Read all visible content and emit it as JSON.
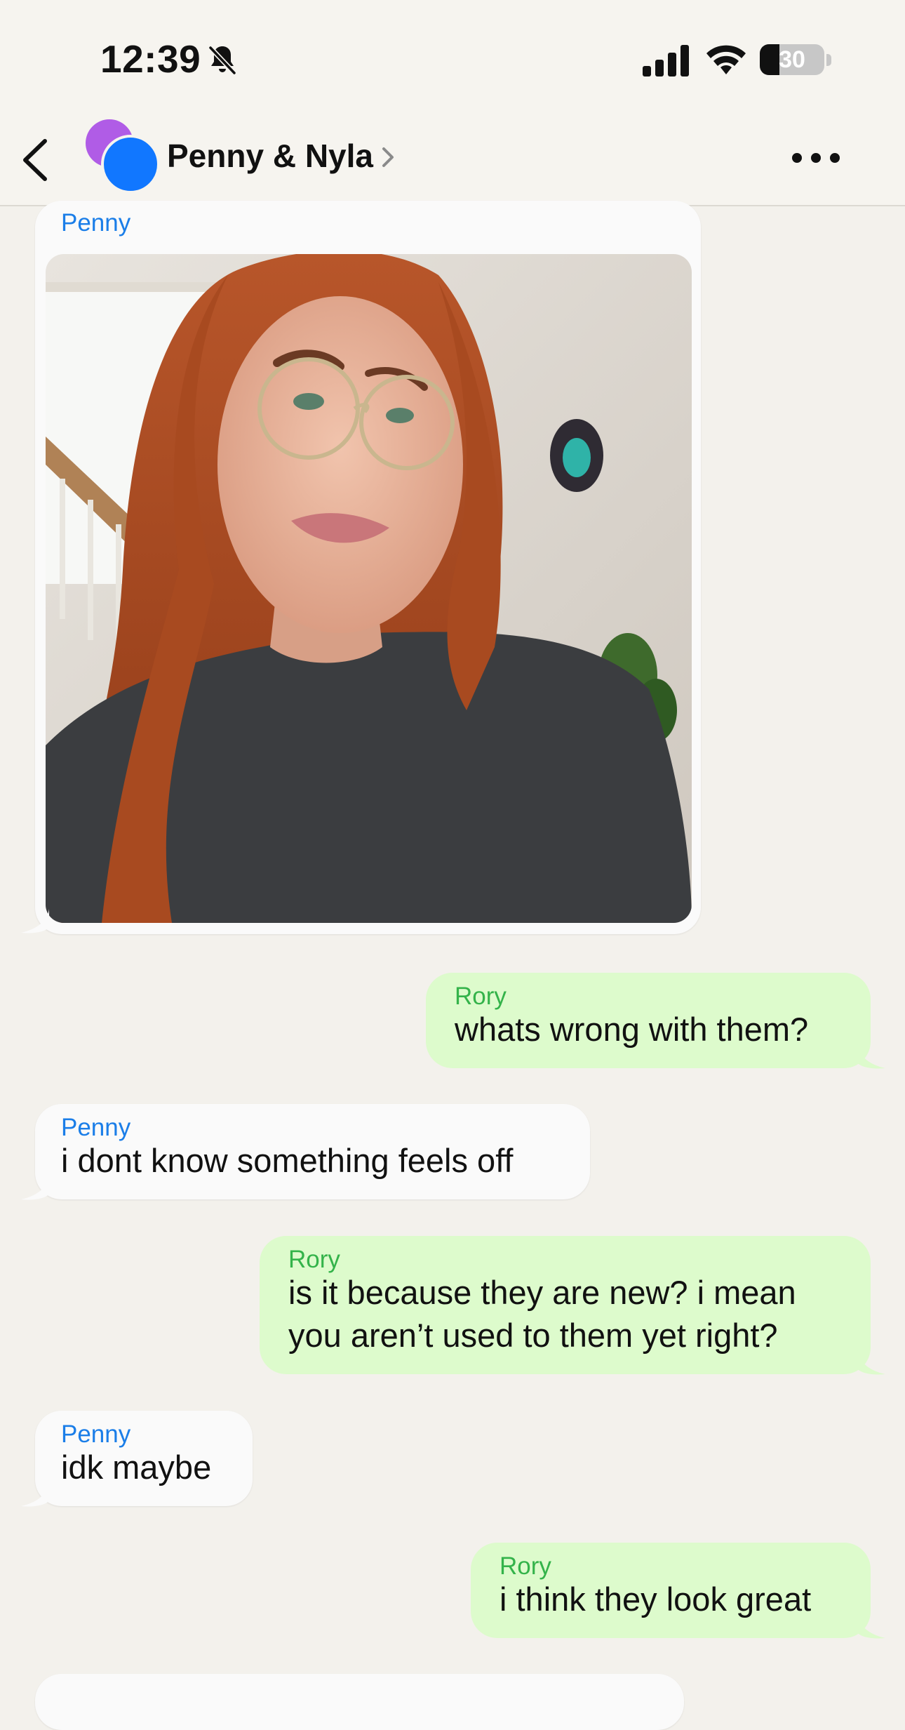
{
  "status_bar": {
    "time": "12:39",
    "battery_level": "30",
    "icons": [
      "bell-slash-icon",
      "cellular-signal-icon",
      "wifi-icon",
      "battery-icon"
    ]
  },
  "header": {
    "title": "Penny & Nyla",
    "icons": [
      "back-chevron-icon",
      "group-avatar",
      "chevron-right-icon",
      "more-dots-icon"
    ],
    "avatar_colors": [
      "#b05ce6",
      "#1177ff"
    ]
  },
  "colors": {
    "incoming_sender": "#1b7ee8",
    "outgoing_sender": "#34b34a",
    "outgoing_bubble": "#ddfbcc",
    "incoming_bubble": "#fafafa"
  },
  "messages": [
    {
      "sender": "Penny",
      "direction": "in",
      "type": "photo",
      "text": ""
    },
    {
      "sender": "Rory",
      "direction": "out",
      "text": "whats wrong with them?"
    },
    {
      "sender": "Penny",
      "direction": "in",
      "text": "i dont know something feels off"
    },
    {
      "sender": "Rory",
      "direction": "out",
      "lines": [
        "is it because they are new? i mean",
        "you aren’t used to them yet right?"
      ]
    },
    {
      "sender": "Penny",
      "direction": "in",
      "text": "idk maybe"
    },
    {
      "sender": "Rory",
      "direction": "out",
      "text": "i think they look great"
    }
  ]
}
